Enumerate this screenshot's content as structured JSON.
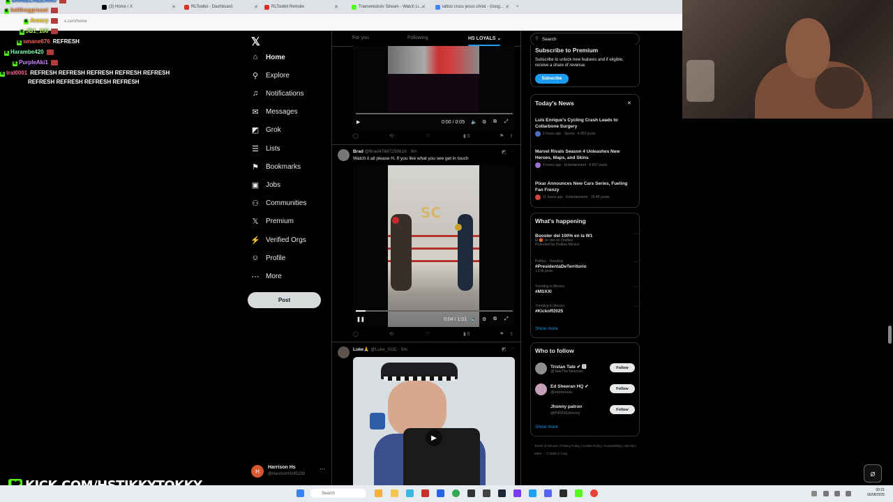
{
  "browser": {
    "tabs": [
      {
        "label": "(3) Home / X",
        "color": "#000000"
      },
      {
        "label": "RLToolkit - Dashboard",
        "color": "#d93025"
      },
      {
        "label": "RLToolkit Remote",
        "color": "#d93025"
      },
      {
        "label": "Trainwreckstv Stream - Watch Li...",
        "color": "#53fc18"
      },
      {
        "label": "tattoo cross jesus christ - Goog...",
        "color": "#4285f4"
      }
    ],
    "new_tab": "+",
    "address": "x.com/home"
  },
  "chat": [
    {
      "user": "DANIELREEANO",
      "msg": "",
      "color": "#3b8cff"
    },
    {
      "user": "holthoggroast",
      "msg": "",
      "color": "#ff9f43"
    },
    {
      "user": "Avsxry",
      "msg": "",
      "color": "#ffd32a"
    },
    {
      "user": "JB1_100",
      "msg": "",
      "color": "#b4ff6a"
    },
    {
      "user": "smane676",
      "msg": "REFRESH",
      "color": "#ff5f5f"
    },
    {
      "user": "Harambe420",
      "msg": "",
      "color": "#7dffb3"
    },
    {
      "user": "PurpleAki1",
      "msg": "",
      "color": "#d48cff"
    },
    {
      "user": "tral0001",
      "msg": "REFRESH REFRESH REFRESH REFRESH REFRESH",
      "color": "#ff5fa0"
    },
    {
      "user": "",
      "msg": "REFRESH REFRESH REFRESH REFRESH",
      "color": "#ffffff"
    }
  ],
  "nav": {
    "logo": "𝕏",
    "items": [
      {
        "label": "Home",
        "icon": "⌂",
        "name": "home"
      },
      {
        "label": "Explore",
        "icon": "⚲",
        "name": "explore"
      },
      {
        "label": "Notifications",
        "icon": "♫",
        "name": "notifications"
      },
      {
        "label": "Messages",
        "icon": "✉",
        "name": "messages"
      },
      {
        "label": "Grok",
        "icon": "◩",
        "name": "grok"
      },
      {
        "label": "Lists",
        "icon": "☰",
        "name": "lists"
      },
      {
        "label": "Bookmarks",
        "icon": "⚑",
        "name": "bookmarks"
      },
      {
        "label": "Jobs",
        "icon": "▣",
        "name": "jobs"
      },
      {
        "label": "Communities",
        "icon": "⚇",
        "name": "communities"
      },
      {
        "label": "Premium",
        "icon": "𝕏",
        "name": "premium"
      },
      {
        "label": "Verified Orgs",
        "icon": "⚡",
        "name": "verified-orgs"
      },
      {
        "label": "Profile",
        "icon": "☺",
        "name": "profile"
      },
      {
        "label": "More",
        "icon": "⋯",
        "name": "more"
      }
    ],
    "post_label": "Post",
    "account": {
      "initial": "H",
      "name": "Harrison Hs",
      "handle": "@HarrisonHs95238",
      "dots": "···"
    }
  },
  "feed": {
    "tabs": [
      "For you",
      "Following",
      "HS LOYALS ⌄"
    ],
    "post1": {
      "time": "0:00 / 0:05",
      "likes": "",
      "views": "6"
    },
    "post2": {
      "name": "Brad",
      "meta": "@Brad47887258616 · 9m",
      "text": "Watch it all please H, If you like what you see get in touch",
      "time": "0:04 / 1:01",
      "views": "6",
      "progress": 0.06
    },
    "post3": {
      "name": "Luke🙏",
      "meta": "@Luke_SUC · 9m"
    },
    "post1_progress": 0.0
  },
  "right": {
    "search_placeholder": "Search",
    "premium": {
      "title": "Subscribe to Premium",
      "body": "Subscribe to unlock new features and if eligible, receive a share of revenue.",
      "button": "Subscribe"
    },
    "news": {
      "title": "Today's News",
      "close": "✕",
      "items": [
        {
          "headline": "Luis Enrique's Cycling Crash Leads to Collarbone Surgery",
          "meta": "2 hours ago · Sports · 4,003 posts",
          "color": "#4a6fbf"
        },
        {
          "headline": "Marvel Rivals Season 4 Unleashes New Heroes, Maps, and Skins",
          "meta": "4 hours ago · Entertainment · 8,697 posts",
          "color": "#9a6fd0"
        },
        {
          "headline": "Pixar Announces New Cars Series, Fueling Fan Frenzy",
          "meta": "11 hours ago · Entertainment · 33.4K posts",
          "color": "#d0453f"
        }
      ]
    },
    "happening": {
      "title": "What's happening",
      "trends": [
        {
          "context": "",
          "title": "Booster del 100% en la W1",
          "sub": "El 🎁 se vive en Draftea",
          "count": "Promoted by Draftea México"
        },
        {
          "context": "Politics · Trending",
          "title": "#PresidentaDeTerritorio",
          "sub": "",
          "count": "1,636 posts"
        },
        {
          "context": "Trending in Mexico",
          "title": "#MSXXI",
          "sub": "",
          "count": ""
        },
        {
          "context": "Trending in Mexico",
          "title": "#Kickoff2025",
          "sub": "",
          "count": ""
        }
      ],
      "more_icon": "···",
      "show_more": "Show more"
    },
    "who_to_follow": {
      "title": "Who to follow",
      "users": [
        {
          "name": "Tristan Tate ✔ 🅱",
          "handle": "@TateTheTalisman",
          "color": "#8f8f8f"
        },
        {
          "name": "Ed Sheeran HQ ✔",
          "handle": "@edsheeran",
          "color": "#c4a0b8"
        },
        {
          "name": "Jhonny patron",
          "handle": "@P45839Jhonny",
          "color": "#000000"
        }
      ],
      "follow": "Follow",
      "show_more": "Show more"
    },
    "footer": "Terms of Service | Privacy Policy | Cookie Policy | Accessibility | Ads info | More ··· © 2025 X Corp."
  },
  "overlay": {
    "kick_text": "KICK.COM/HSTIKKYTOKKY",
    "k": "K"
  },
  "taskbar": {
    "search_placeholder": "Search",
    "time": "00:21",
    "date": "06/08/2025"
  }
}
